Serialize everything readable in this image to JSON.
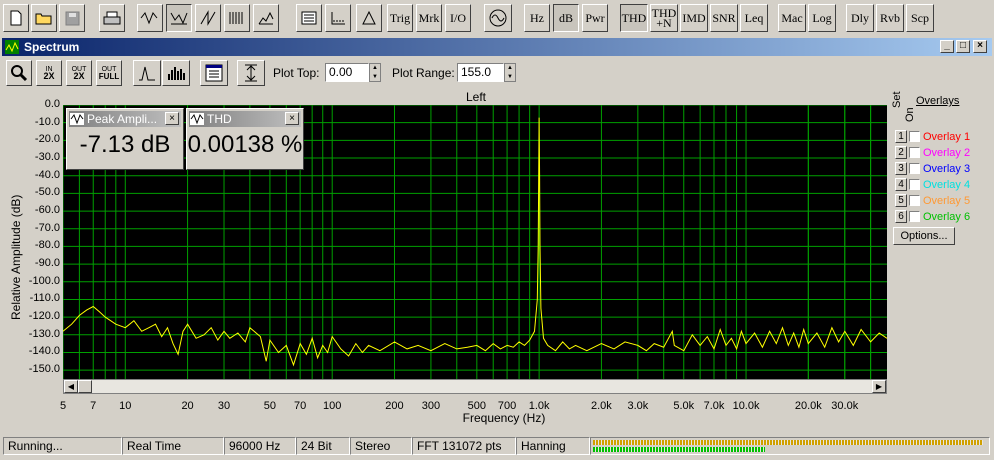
{
  "toolbar": {
    "text_buttons": [
      {
        "label": "Trig"
      },
      {
        "label": "Mrk"
      },
      {
        "label": "I/O"
      },
      {
        "label": "Hz"
      },
      {
        "label": "dB"
      },
      {
        "label": "Pwr"
      },
      {
        "label": "THD"
      },
      {
        "label": "THD\n+N"
      },
      {
        "label": "IMD"
      },
      {
        "label": "SNR"
      },
      {
        "label": "Leq"
      },
      {
        "label": "Mac"
      },
      {
        "label": "Log"
      },
      {
        "label": "Dly"
      },
      {
        "label": "Rvb"
      },
      {
        "label": "Scp"
      }
    ]
  },
  "window": {
    "title": "Spectrum",
    "min": "_",
    "max": "□",
    "close": "×"
  },
  "subtoolbar": {
    "zoom_in": {
      "top": "IN",
      "bottom": "2X"
    },
    "zoom_out": {
      "top": "OUT",
      "bottom": "2X"
    },
    "zoom_full": {
      "top": "OUT",
      "bottom": "FULL"
    },
    "plot_top_label": "Plot Top:",
    "plot_top_value": "0.00",
    "plot_range_label": "Plot Range:",
    "plot_range_value": "155.0"
  },
  "chart_data": {
    "type": "line",
    "title": "Left",
    "xlabel": "Frequency (Hz)",
    "ylabel": "Relative Amplitude (dB)",
    "x_scale": "log",
    "xlim": [
      5,
      48000
    ],
    "ylim": [
      -155,
      0
    ],
    "grid": true,
    "background": "#000000",
    "grid_color": "#00a000",
    "line_color": "#ffff00",
    "yticks": [
      "0.0",
      "-10.0",
      "-20.0",
      "-30.0",
      "-40.0",
      "-50.0",
      "-60.0",
      "-70.0",
      "-80.0",
      "-90.0",
      "-100.0",
      "-110.0",
      "-120.0",
      "-130.0",
      "-140.0",
      "-150.0"
    ],
    "xticks": [
      {
        "v": 5,
        "l": "5"
      },
      {
        "v": 7,
        "l": "7"
      },
      {
        "v": 10,
        "l": "10"
      },
      {
        "v": 20,
        "l": "20"
      },
      {
        "v": 30,
        "l": "30"
      },
      {
        "v": 50,
        "l": "50"
      },
      {
        "v": 70,
        "l": "70"
      },
      {
        "v": 100,
        "l": "100"
      },
      {
        "v": 200,
        "l": "200"
      },
      {
        "v": 300,
        "l": "300"
      },
      {
        "v": 500,
        "l": "500"
      },
      {
        "v": 700,
        "l": "700"
      },
      {
        "v": 1000,
        "l": "1.0k"
      },
      {
        "v": 2000,
        "l": "2.0k"
      },
      {
        "v": 3000,
        "l": "3.0k"
      },
      {
        "v": 5000,
        "l": "5.0k"
      },
      {
        "v": 7000,
        "l": "7.0k"
      },
      {
        "v": 10000,
        "l": "10.0k"
      },
      {
        "v": 20000,
        "l": "20.0k"
      },
      {
        "v": 30000,
        "l": "30.0k"
      }
    ],
    "series": [
      {
        "points": [
          [
            5,
            -128
          ],
          [
            5.5,
            -124
          ],
          [
            6,
            -119
          ],
          [
            6.5,
            -116
          ],
          [
            7,
            -114
          ],
          [
            7.5,
            -117
          ],
          [
            8,
            -120
          ],
          [
            9,
            -124
          ],
          [
            10,
            -126
          ],
          [
            11,
            -122
          ],
          [
            12,
            -128
          ],
          [
            13,
            -126
          ],
          [
            14,
            -124
          ],
          [
            15,
            -131
          ],
          [
            16,
            -126
          ],
          [
            17,
            -135
          ],
          [
            18,
            -141
          ],
          [
            19,
            -128
          ],
          [
            20,
            -124
          ],
          [
            22,
            -132
          ],
          [
            24,
            -130
          ],
          [
            26,
            -126
          ],
          [
            28,
            -133
          ],
          [
            30,
            -128
          ],
          [
            32,
            -132
          ],
          [
            35,
            -129
          ],
          [
            38,
            -134
          ],
          [
            40,
            -126
          ],
          [
            45,
            -131
          ],
          [
            48,
            -145
          ],
          [
            50,
            -133
          ],
          [
            55,
            -140
          ],
          [
            60,
            -136
          ],
          [
            65,
            -147
          ],
          [
            70,
            -135
          ],
          [
            75,
            -141
          ],
          [
            80,
            -132
          ],
          [
            85,
            -143
          ],
          [
            90,
            -136
          ],
          [
            95,
            -140
          ],
          [
            100,
            -131
          ],
          [
            110,
            -138
          ],
          [
            120,
            -142
          ],
          [
            130,
            -135
          ],
          [
            140,
            -140
          ],
          [
            150,
            -136
          ],
          [
            170,
            -139
          ],
          [
            200,
            -134
          ],
          [
            230,
            -138
          ],
          [
            260,
            -136
          ],
          [
            300,
            -139
          ],
          [
            350,
            -135
          ],
          [
            400,
            -138
          ],
          [
            450,
            -137
          ],
          [
            500,
            -136
          ],
          [
            550,
            -139
          ],
          [
            600,
            -135
          ],
          [
            650,
            -138
          ],
          [
            700,
            -136
          ],
          [
            750,
            -137
          ],
          [
            800,
            -134
          ],
          [
            850,
            -136
          ],
          [
            900,
            -133
          ],
          [
            950,
            -128
          ],
          [
            980,
            -110
          ],
          [
            990,
            -80
          ],
          [
            995,
            -40
          ],
          [
            1000,
            -7.13
          ],
          [
            1005,
            -40
          ],
          [
            1010,
            -80
          ],
          [
            1020,
            -115
          ],
          [
            1050,
            -132
          ],
          [
            1100,
            -136
          ],
          [
            1200,
            -139
          ],
          [
            1300,
            -134
          ],
          [
            1400,
            -138
          ],
          [
            1500,
            -136
          ],
          [
            1700,
            -139
          ],
          [
            2000,
            -135
          ],
          [
            2300,
            -138
          ],
          [
            2600,
            -134
          ],
          [
            3000,
            -136
          ],
          [
            3300,
            -139
          ],
          [
            3600,
            -135
          ],
          [
            4000,
            -137
          ],
          [
            4400,
            -128
          ],
          [
            4500,
            -136
          ],
          [
            5000,
            -139
          ],
          [
            5500,
            -130
          ],
          [
            6000,
            -136
          ],
          [
            6500,
            -131
          ],
          [
            7000,
            -138
          ],
          [
            7500,
            -127
          ],
          [
            8000,
            -136
          ],
          [
            8500,
            -132
          ],
          [
            9000,
            -138
          ],
          [
            9500,
            -128
          ],
          [
            10000,
            -135
          ],
          [
            11000,
            -129
          ],
          [
            12000,
            -137
          ],
          [
            13000,
            -128
          ],
          [
            14000,
            -135
          ],
          [
            15000,
            -126
          ],
          [
            16000,
            -136
          ],
          [
            17000,
            -129
          ],
          [
            18000,
            -137
          ],
          [
            19000,
            -127
          ],
          [
            20000,
            -135
          ],
          [
            22000,
            -129
          ],
          [
            24000,
            -137
          ],
          [
            26000,
            -126
          ],
          [
            28000,
            -134
          ],
          [
            30000,
            -128
          ],
          [
            33000,
            -136
          ],
          [
            36000,
            -127
          ],
          [
            40000,
            -134
          ],
          [
            44000,
            -129
          ],
          [
            48000,
            -132
          ]
        ]
      }
    ]
  },
  "meters": [
    {
      "title": "Peak Ampli...",
      "value": "-7.13 dB"
    },
    {
      "title": "THD",
      "value": "0.00138 %"
    }
  ],
  "overlays": {
    "set_label": "Set",
    "on_label": "On",
    "title": "Overlays",
    "items": [
      {
        "num": "1",
        "label": "Overlay 1",
        "color": "#ff0000"
      },
      {
        "num": "2",
        "label": "Overlay 2",
        "color": "#ff00ff"
      },
      {
        "num": "3",
        "label": "Overlay 3",
        "color": "#0000ff"
      },
      {
        "num": "4",
        "label": "Overlay 4",
        "color": "#00e0e0"
      },
      {
        "num": "5",
        "label": "Overlay 5",
        "color": "#ff9933"
      },
      {
        "num": "6",
        "label": "Overlay 6",
        "color": "#00c000"
      }
    ],
    "options_label": "Options..."
  },
  "status": {
    "state": "Running...",
    "mode": "Real Time",
    "rate": "96000 Hz",
    "bits": "24 Bit",
    "channels": "Stereo",
    "fft": "FFT 131072 pts",
    "window": "Hanning"
  }
}
